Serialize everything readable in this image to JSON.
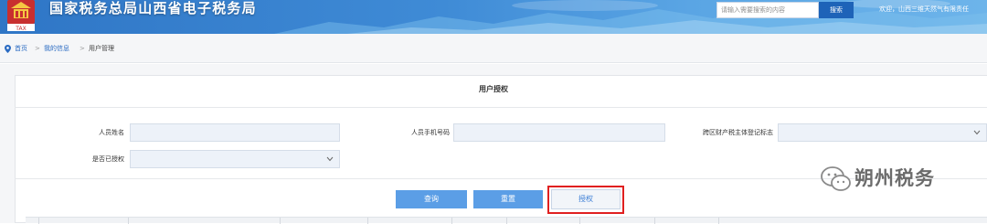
{
  "header": {
    "site_title": "国家税务总局山西省电子税务局",
    "search_placeholder": "请输入需要搜索的内容",
    "search_button": "搜索",
    "welcome_text": "欢迎，山西三维天然气有限责任"
  },
  "breadcrumb": {
    "items": [
      "首页",
      "我的信息",
      "用户管理"
    ],
    "separator": ">"
  },
  "panel": {
    "title": "用户授权"
  },
  "form": {
    "name_label": "人员姓名",
    "name_value": "",
    "phone_label": "人员手机号码",
    "phone_value": "",
    "cross_region_label": "跨区财产税主体登记标志",
    "cross_region_value": "",
    "authorized_label": "是否已授权",
    "authorized_value": ""
  },
  "buttons": {
    "query": "查询",
    "reset": "重置",
    "authorize": "授权"
  },
  "watermark": {
    "text": "朔州税务"
  },
  "colors": {
    "header_blue": "#2f76c6",
    "button_blue": "#5b9ee6",
    "highlight_red": "#e02020",
    "link_blue": "#2a6bc2"
  }
}
